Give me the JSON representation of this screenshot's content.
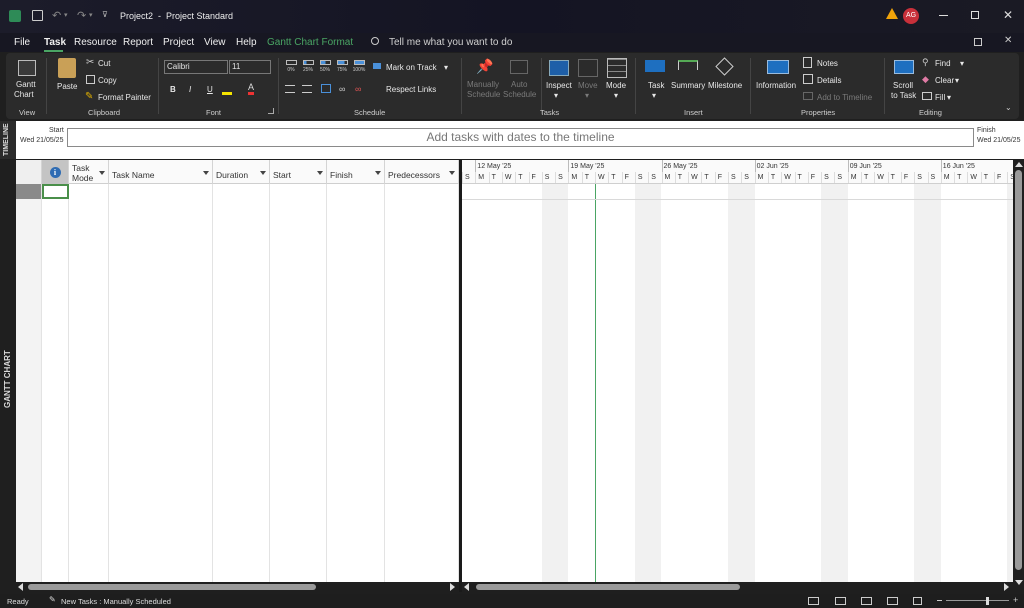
{
  "titlebar": {
    "title": "Project2  -  Project Standard",
    "avatar": "AG"
  },
  "menu": {
    "tabs": [
      "File",
      "Task",
      "Resource",
      "Report",
      "Project",
      "View",
      "Help",
      "Gantt Chart Format"
    ],
    "active": "Task",
    "search": "Tell me what you want to do"
  },
  "ribbon": {
    "view": {
      "gantt1": "Gantt",
      "gantt2": "Chart",
      "label": "View"
    },
    "clipboard": {
      "paste": "Paste",
      "cut": "Cut",
      "copy": "Copy",
      "format_painter": "Format Painter",
      "label": "Clipboard"
    },
    "font": {
      "family": "Calibri",
      "size": "11",
      "bold": "B",
      "italic": "I",
      "underline": "U",
      "label": "Font"
    },
    "schedule": {
      "pcts": [
        "0%",
        "25%",
        "50%",
        "75%",
        "100%"
      ],
      "mark_on_track": "Mark on Track",
      "respect_links": "Respect Links",
      "label": "Schedule"
    },
    "tasks": {
      "manually1": "Manually",
      "manually2": "Schedule",
      "auto1": "Auto",
      "auto2": "Schedule",
      "inspect": "Inspect",
      "move": "Move",
      "mode": "Mode",
      "label": "Tasks"
    },
    "insert": {
      "task": "Task",
      "summary": "Summary",
      "milestone": "Milestone",
      "label": "Insert"
    },
    "properties": {
      "information": "Information",
      "notes": "Notes",
      "details": "Details",
      "add_to_timeline": "Add to Timeline",
      "label": "Properties"
    },
    "editing": {
      "scroll1": "Scroll",
      "scroll2": "to Task",
      "find": "Find",
      "clear": "Clear",
      "fill": "Fill",
      "label": "Editing"
    }
  },
  "timeline": {
    "side": "TIMELINE",
    "start_label": "Start",
    "start_date": "Wed 21/05/25",
    "placeholder": "Add tasks with dates to the timeline",
    "finish_label": "Finish",
    "finish_date": "Wed 21/05/25"
  },
  "grid": {
    "info": "i",
    "mode1": "Task",
    "mode2": "Mode",
    "name": "Task Name",
    "duration": "Duration",
    "start": "Start",
    "finish": "Finish",
    "predecessors": "Predecessors"
  },
  "chart": {
    "weeks": [
      "12 May '25",
      "19 May '25",
      "26 May '25",
      "02 Jun '25",
      "09 Jun '25",
      "16 Jun '25"
    ],
    "days": [
      "S",
      "M",
      "T",
      "W",
      "T",
      "F",
      "S",
      "S",
      "M",
      "T",
      "W",
      "T",
      "F",
      "S",
      "S",
      "M",
      "T",
      "W",
      "T",
      "F",
      "S",
      "S",
      "M",
      "T",
      "W",
      "T",
      "F",
      "S",
      "S",
      "M",
      "T",
      "W",
      "T",
      "F",
      "S",
      "S",
      "M",
      "T",
      "W",
      "T",
      "F",
      "S"
    ]
  },
  "side": {
    "gantt": "GANTT CHART"
  },
  "status": {
    "ready": "Ready",
    "new_tasks": "New Tasks : Manually Scheduled"
  },
  "colors": {
    "accent": "#4aa564",
    "ribbon": "#2b2b2b",
    "warning": "#f0a30a",
    "avatar": "#c8303a"
  }
}
